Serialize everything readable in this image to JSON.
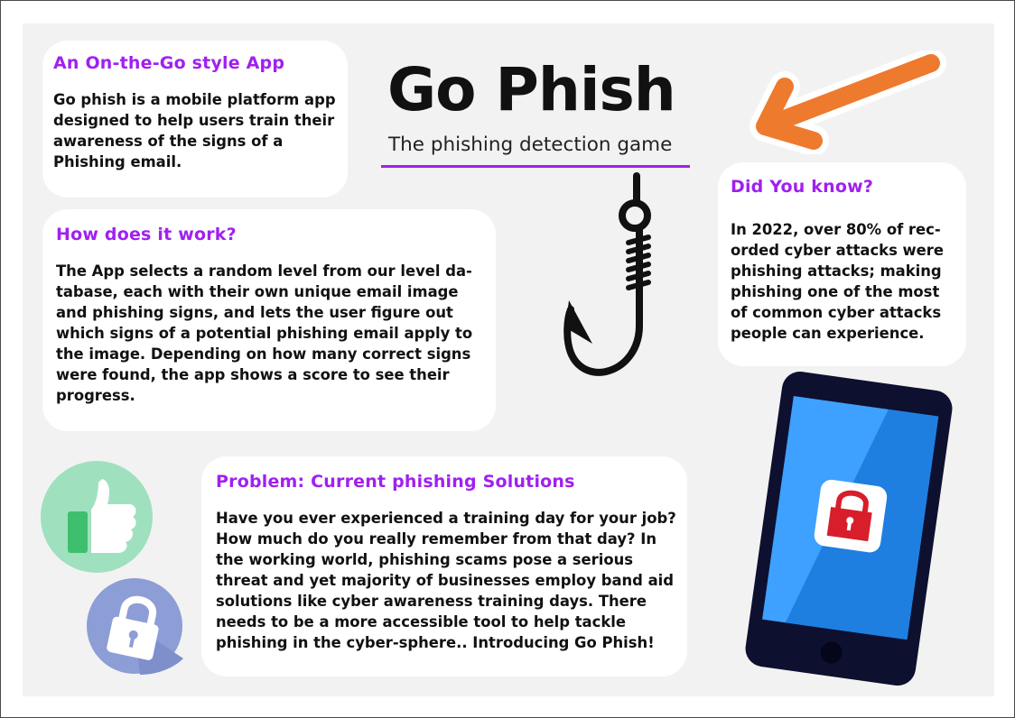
{
  "title": "Go Phish",
  "subtitle": "The phishing detection game",
  "intro": {
    "heading": "An On-the-Go style App",
    "body": "Go phish is a mobile platform app designed to help users train their awareness of the signs of a Phishing email."
  },
  "how": {
    "heading": "How does it work?",
    "body": "The App selects a random level from our level da-tabase, each with their own unique email image and phishing signs, and lets the user figure out which signs of a potential phishing email apply to the image. Depending on how many correct signs were found, the app shows a score to see their progress."
  },
  "know": {
    "heading": "Did You know?",
    "body": "In 2022, over 80% of rec-orded cyber attacks were phishing attacks; making phishing one of the most of common cyber attacks people can experience."
  },
  "problem": {
    "heading": "Problem: Current phishing Solutions",
    "body": "Have you ever experienced a training day for your job? How much do you really remember from that day? In the working world, phishing scams pose a serious threat and yet majority of businesses employ band aid solutions like cyber awareness training days. There needs to be a more accessible tool to help tackle phishing in the cyber-sphere.. Introducing Go Phish!"
  },
  "icons": {
    "arrow": "arrow-icon",
    "hook": "fish-hook-icon",
    "thumbs": "thumbs-up-icon",
    "lock": "padlock-icon",
    "phone": "smartphone-lock-icon"
  },
  "colors": {
    "heading": "#a020f0",
    "accent_orange": "#ee7a2e",
    "thumb_bg": "#9fe0bf",
    "lock_bg": "#8d9dd6",
    "phone_screen": "#1e88e5",
    "lock_red": "#d81e2a"
  }
}
